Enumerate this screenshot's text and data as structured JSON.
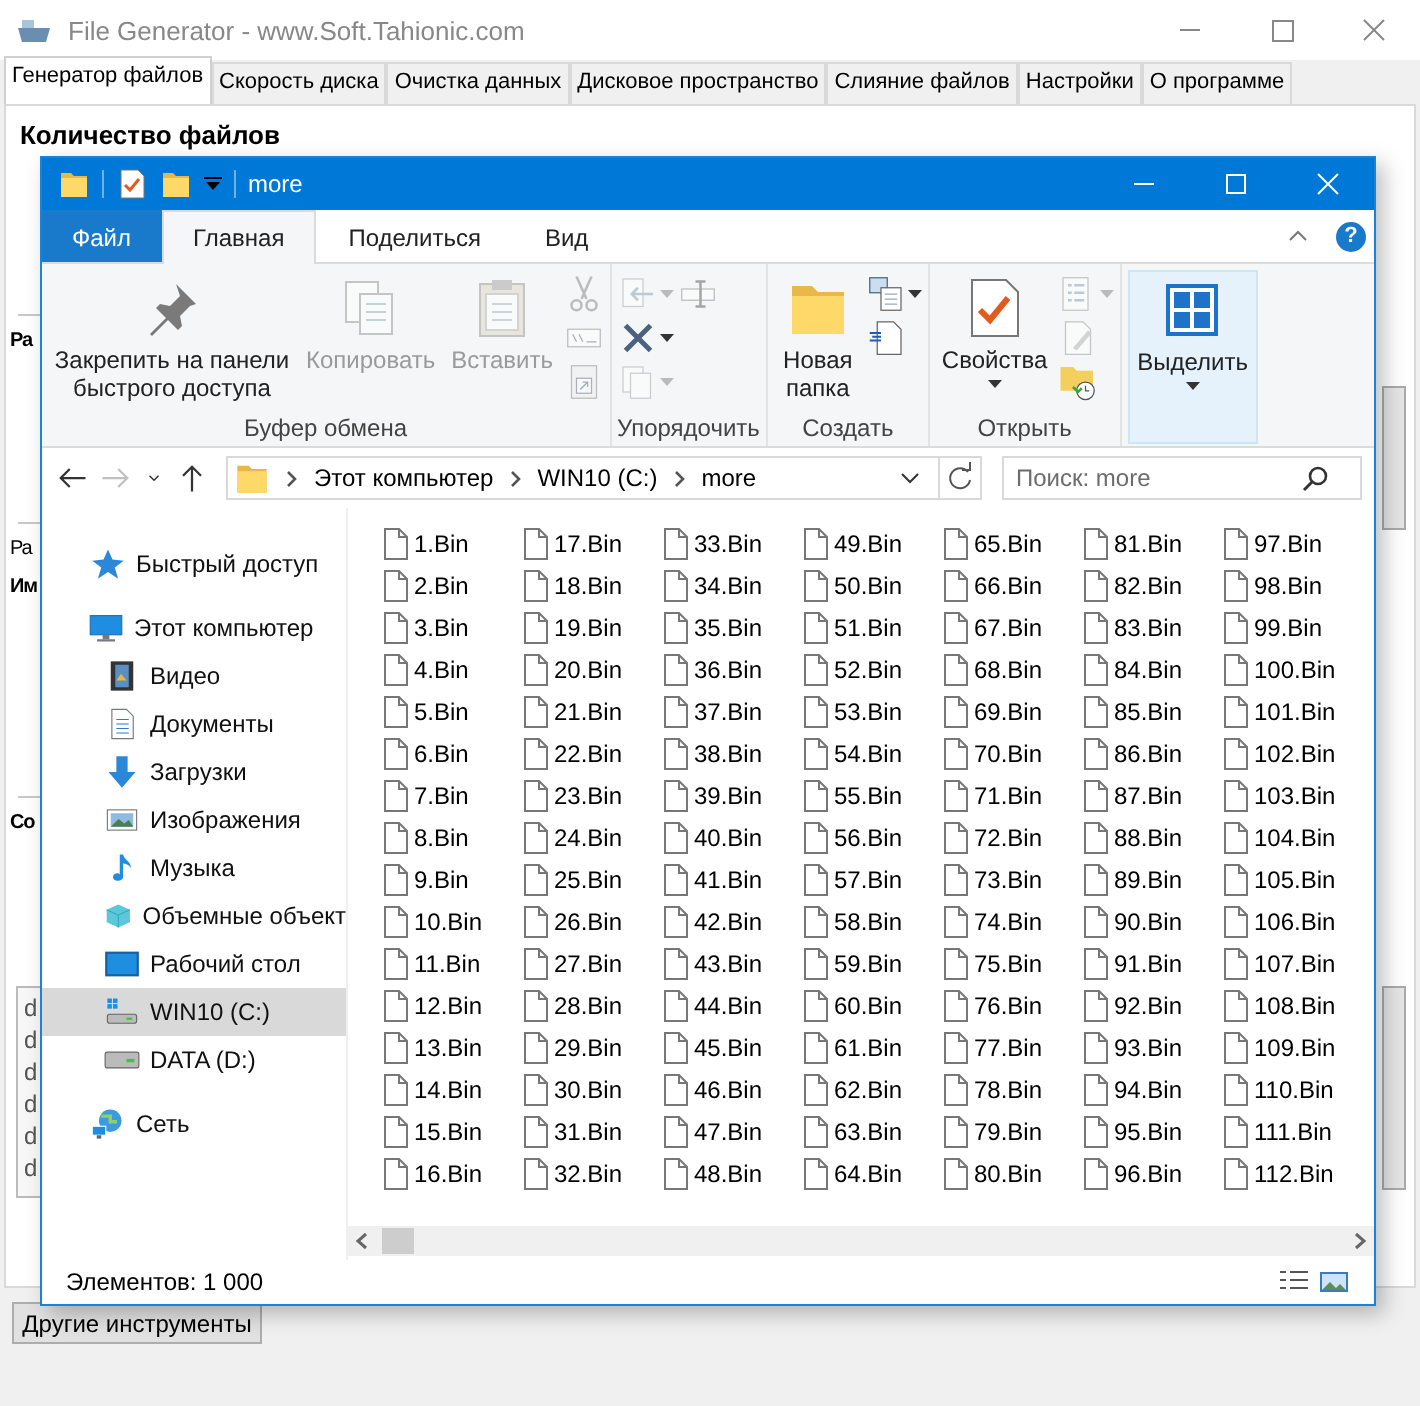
{
  "app": {
    "title": "File Generator  -  www.Soft.Tahionic.com",
    "tabs": [
      {
        "label": "Генератор файлов",
        "selected": true
      },
      {
        "label": "Скорость диска",
        "selected": false
      },
      {
        "label": "Очистка данных",
        "selected": false
      },
      {
        "label": "Дисковое пространство",
        "selected": false
      },
      {
        "label": "Слияние файлов",
        "selected": false
      },
      {
        "label": "Настройки",
        "selected": false
      },
      {
        "label": "О программе",
        "selected": false
      }
    ],
    "heading": "Количество файлов",
    "fragments": [
      {
        "text": "Ра",
        "kind": "heading"
      },
      {
        "text": "Ра",
        "kind": "label"
      },
      {
        "text": "Им",
        "kind": "heading"
      },
      {
        "text": "Со",
        "kind": "heading"
      }
    ],
    "list_items": [
      "d",
      "d",
      "d",
      "d",
      "d",
      "d"
    ],
    "button": "Другие инструменты"
  },
  "explorer": {
    "title": "more",
    "ribbon_tabs": [
      {
        "label": "Файл",
        "kind": "file",
        "selected": false
      },
      {
        "label": "Главная",
        "kind": "tab",
        "selected": true
      },
      {
        "label": "Поделиться",
        "kind": "tab",
        "selected": false
      },
      {
        "label": "Вид",
        "kind": "tab",
        "selected": false
      }
    ],
    "help": "?",
    "groups": [
      {
        "label": "Буфер обмена",
        "large": [
          {
            "kind": "pin",
            "label": "Закрепить на панели быстрого доступа",
            "disabled": false,
            "highlighted": false
          },
          {
            "kind": "copy",
            "label": "Копировать",
            "disabled": true,
            "highlighted": false
          },
          {
            "kind": "paste",
            "label": "Вставить",
            "disabled": true,
            "highlighted": false
          }
        ],
        "small": [
          {
            "kind": "cut",
            "disabled": true
          },
          {
            "kind": "path",
            "disabled": true
          },
          {
            "kind": "shortcut",
            "disabled": true
          }
        ]
      },
      {
        "label": "Упорядочить",
        "small": [
          {
            "kind": "moveto",
            "disabled": true
          },
          {
            "kind": "delete",
            "disabled": false
          },
          {
            "kind": "copyto",
            "disabled": true
          },
          {
            "kind": "rename",
            "disabled": true
          }
        ]
      },
      {
        "label": "Создать",
        "large": [
          {
            "kind": "folder",
            "label": "Новая папка",
            "disabled": false,
            "highlighted": false
          }
        ],
        "small": [
          {
            "kind": "newitem",
            "disabled": false
          },
          {
            "kind": "easy",
            "disabled": false
          }
        ]
      },
      {
        "label": "Открыть",
        "large": [
          {
            "kind": "properties",
            "label": "Свойства",
            "disabled": false,
            "highlighted": false
          }
        ],
        "small": [
          {
            "kind": "open",
            "disabled": true
          },
          {
            "kind": "edit",
            "disabled": true
          },
          {
            "kind": "history",
            "disabled": false
          }
        ]
      },
      {
        "large": [
          {
            "kind": "select",
            "label": "Выделить",
            "disabled": false,
            "highlighted": true
          }
        ]
      }
    ],
    "nav_buttons": [
      {
        "kind": "back",
        "disabled": false
      },
      {
        "kind": "forward",
        "disabled": true
      },
      {
        "kind": "recent",
        "disabled": false
      },
      {
        "kind": "up",
        "disabled": false
      }
    ],
    "breadcrumbs": [
      "Этот компьютер",
      "WIN10 (C:)",
      "more"
    ],
    "search": {
      "placeholder": "Поиск: more"
    },
    "nav": [
      {
        "label": "Быстрый доступ",
        "kind": "quick",
        "selected": false
      },
      {
        "label": "Этот компьютер",
        "kind": "computer",
        "selected": false,
        "children": [
          {
            "label": "Видео",
            "kind": "video",
            "selected": false
          },
          {
            "label": "Документы",
            "kind": "docs",
            "selected": false
          },
          {
            "label": "Загрузки",
            "kind": "downloads",
            "selected": false
          },
          {
            "label": "Изображения",
            "kind": "images",
            "selected": false
          },
          {
            "label": "Музыка",
            "kind": "music",
            "selected": false
          },
          {
            "label": "Объемные объект",
            "kind": "objects",
            "selected": false
          },
          {
            "label": "Рабочий стол",
            "kind": "desktop",
            "selected": false
          },
          {
            "label": "WIN10 (C:)",
            "kind": "sysdrive",
            "selected": true
          },
          {
            "label": "DATA (D:)",
            "kind": "drive",
            "selected": false
          }
        ]
      },
      {
        "label": "Сеть",
        "kind": "network",
        "selected": false
      }
    ],
    "files": [
      "1.Bin",
      "2.Bin",
      "3.Bin",
      "4.Bin",
      "5.Bin",
      "6.Bin",
      "7.Bin",
      "8.Bin",
      "9.Bin",
      "10.Bin",
      "11.Bin",
      "12.Bin",
      "13.Bin",
      "14.Bin",
      "15.Bin",
      "16.Bin",
      "17.Bin",
      "18.Bin",
      "19.Bin",
      "20.Bin",
      "21.Bin",
      "22.Bin",
      "23.Bin",
      "24.Bin",
      "25.Bin",
      "26.Bin",
      "27.Bin",
      "28.Bin",
      "29.Bin",
      "30.Bin",
      "31.Bin",
      "32.Bin",
      "33.Bin",
      "34.Bin",
      "35.Bin",
      "36.Bin",
      "37.Bin",
      "38.Bin",
      "39.Bin",
      "40.Bin",
      "41.Bin",
      "42.Bin",
      "43.Bin",
      "44.Bin",
      "45.Bin",
      "46.Bin",
      "47.Bin",
      "48.Bin",
      "49.Bin",
      "50.Bin",
      "51.Bin",
      "52.Bin",
      "53.Bin",
      "54.Bin",
      "55.Bin",
      "56.Bin",
      "57.Bin",
      "58.Bin",
      "59.Bin",
      "60.Bin",
      "61.Bin",
      "62.Bin",
      "63.Bin",
      "64.Bin",
      "65.Bin",
      "66.Bin",
      "67.Bin",
      "68.Bin",
      "69.Bin",
      "70.Bin",
      "71.Bin",
      "72.Bin",
      "73.Bin",
      "74.Bin",
      "75.Bin",
      "76.Bin",
      "77.Bin",
      "78.Bin",
      "79.Bin",
      "80.Bin",
      "81.Bin",
      "82.Bin",
      "83.Bin",
      "84.Bin",
      "85.Bin",
      "86.Bin",
      "87.Bin",
      "88.Bin",
      "89.Bin",
      "90.Bin",
      "91.Bin",
      "92.Bin",
      "93.Bin",
      "94.Bin",
      "95.Bin",
      "96.Bin",
      "97.Bin",
      "98.Bin",
      "99.Bin",
      "100.Bin",
      "101.Bin",
      "102.Bin",
      "103.Bin",
      "104.Bin",
      "105.Bin",
      "106.Bin",
      "107.Bin",
      "108.Bin",
      "109.Bin",
      "110.Bin",
      "111.Bin",
      "112.Bin"
    ],
    "status": "Элементов: 1 000"
  }
}
